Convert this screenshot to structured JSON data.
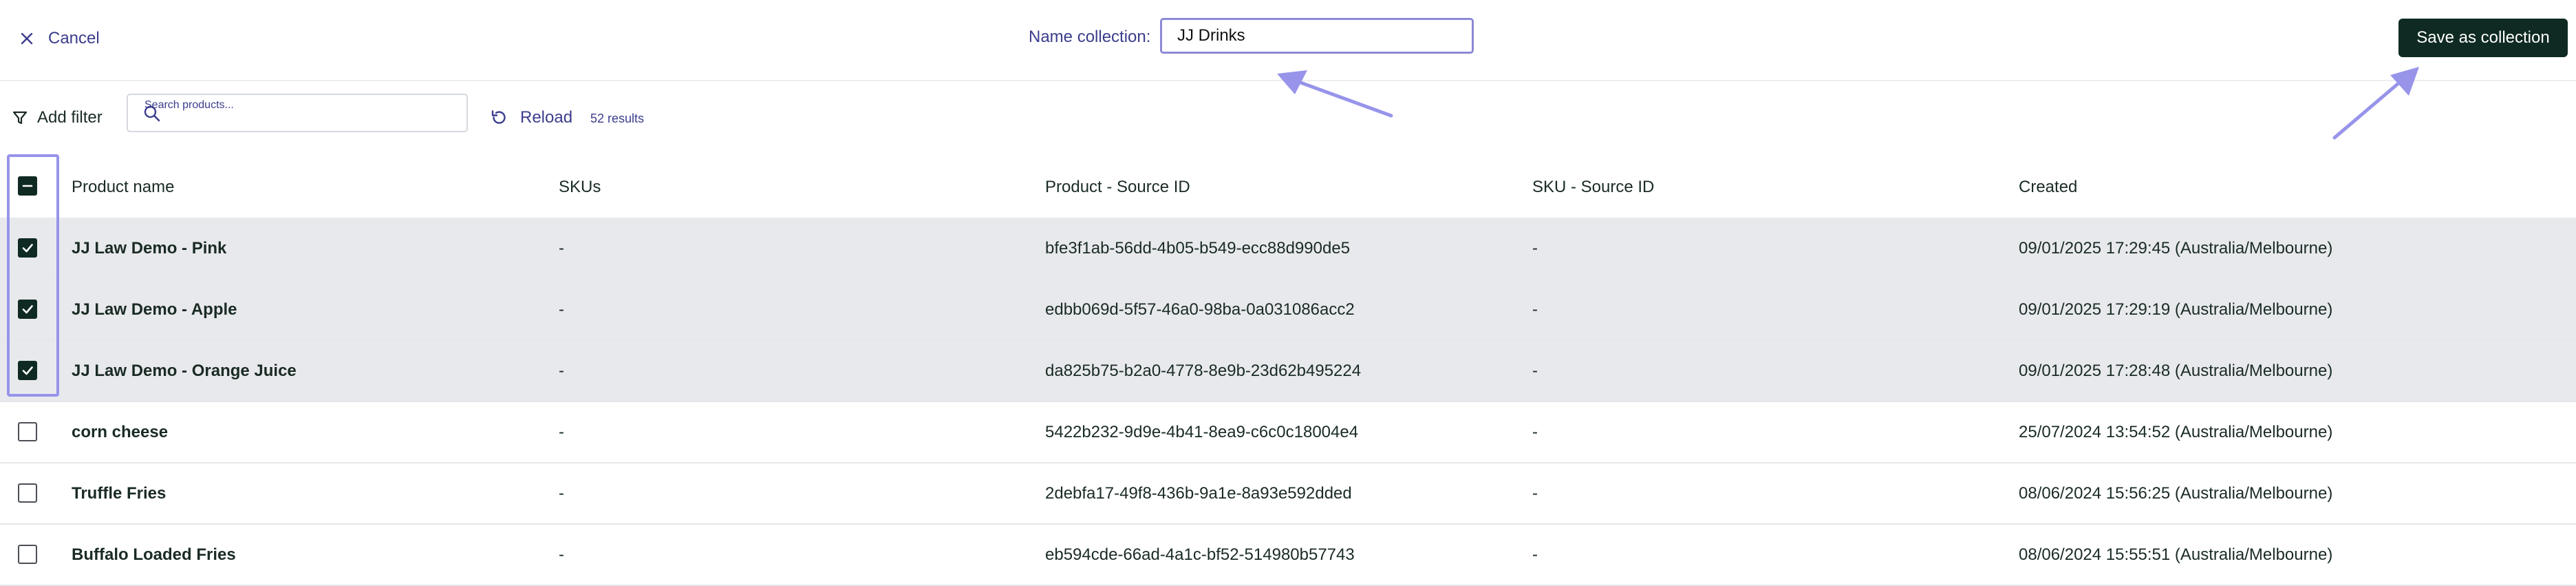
{
  "header": {
    "cancel_label": "Cancel",
    "name_label": "Name collection:",
    "name_value": "JJ Drinks",
    "save_label": "Save as collection"
  },
  "toolbar": {
    "add_filter_label": "Add filter",
    "search_label": "Search products...",
    "search_value": "",
    "reload_label": "Reload",
    "results": "52 results"
  },
  "table": {
    "columns": [
      "Product name",
      "SKUs",
      "Product - Source ID",
      "SKU - Source ID",
      "Created"
    ],
    "select_all_state": "indeterminate",
    "rows": [
      {
        "name": "JJ Law Demo - Pink",
        "skus": "-",
        "product_source_id": "bfe3f1ab-56dd-4b05-b549-ecc88d990de5",
        "sku_source_id": "-",
        "created": "09/01/2025 17:29:45 (Australia/Melbourne)",
        "checked": true
      },
      {
        "name": "JJ Law Demo - Apple",
        "skus": "-",
        "product_source_id": "edbb069d-5f57-46a0-98ba-0a031086acc2",
        "sku_source_id": "-",
        "created": "09/01/2025 17:29:19 (Australia/Melbourne)",
        "checked": true
      },
      {
        "name": "JJ Law Demo - Orange Juice",
        "skus": "-",
        "product_source_id": "da825b75-b2a0-4778-8e9b-23d62b495224",
        "sku_source_id": "-",
        "created": "09/01/2025 17:28:48 (Australia/Melbourne)",
        "checked": true
      },
      {
        "name": "corn cheese",
        "skus": "-",
        "product_source_id": "5422b232-9d9e-4b41-8ea9-c6c0c18004e4",
        "sku_source_id": "-",
        "created": "25/07/2024 13:54:52 (Australia/Melbourne)",
        "checked": false
      },
      {
        "name": "Truffle Fries",
        "skus": "-",
        "product_source_id": "2debfa17-49f8-436b-9a1e-8a93e592dded",
        "sku_source_id": "-",
        "created": "08/06/2024 15:56:25 (Australia/Melbourne)",
        "checked": false
      },
      {
        "name": "Buffalo Loaded Fries",
        "skus": "-",
        "product_source_id": "eb594cde-66ad-4a1c-bf52-514980b57743",
        "sku_source_id": "-",
        "created": "08/06/2024 15:55:51 (Australia/Melbourne)",
        "checked": false
      }
    ]
  },
  "icons": {
    "cancel": "close-icon",
    "filter": "filter-icon",
    "search": "search-icon",
    "reload": "reload-icon"
  },
  "colors": {
    "primary_dark": "#0f2a22",
    "link_indigo": "#3b3d8c",
    "selected_row": "#e8e9ed",
    "annotation": "#9794ea"
  }
}
